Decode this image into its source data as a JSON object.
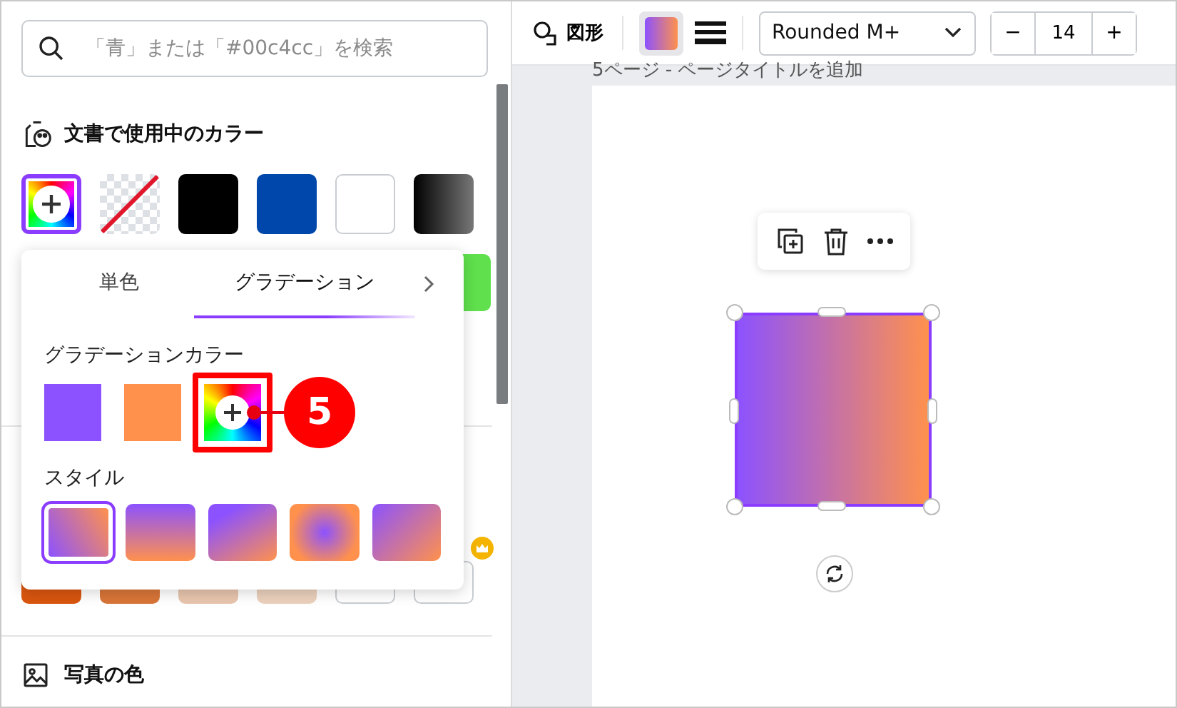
{
  "search": {
    "placeholder": "「青」または「#00c4cc」を検索"
  },
  "document_colors": {
    "title": "文書で使用中のカラー",
    "swatches": [
      {
        "kind": "add",
        "selected": true
      },
      {
        "kind": "none",
        "selected": false
      },
      {
        "kind": "solid",
        "color": "#000000",
        "selected": false
      },
      {
        "kind": "solid",
        "color": "#0047ab",
        "selected": false
      },
      {
        "kind": "solid",
        "color": "#ffffff",
        "selected": false
      },
      {
        "kind": "gradient",
        "color": "#000000",
        "selected": false
      }
    ]
  },
  "partly_hidden": {
    "top_swatch": {
      "color": "#5fe04c"
    },
    "bottom_swatches": [
      {
        "color": "#d9560f"
      },
      {
        "color": "#d97538"
      },
      {
        "color": "#e8c5ae"
      },
      {
        "color": "#ebd1bd"
      },
      {
        "color": "#ffffff"
      },
      {
        "color": "#ffffff"
      }
    ]
  },
  "popover": {
    "tabs": [
      {
        "label": "単色",
        "selected": false
      },
      {
        "label": "グラデーション",
        "selected": true
      }
    ],
    "gradient_colors": {
      "title": "グラデーションカラー",
      "swatches": [
        {
          "kind": "solid",
          "color": "#8c52ff",
          "highlighted": false
        },
        {
          "kind": "solid",
          "color": "#ff914d",
          "highlighted": false
        },
        {
          "kind": "add",
          "highlighted": true
        }
      ]
    },
    "callout": {
      "label": "5"
    },
    "styles": {
      "title": "スタイル",
      "items": [
        {
          "kind": "diagonal",
          "selected": true
        },
        {
          "kind": "vertical",
          "selected": false
        },
        {
          "kind": "diagonal-soft",
          "selected": false
        },
        {
          "kind": "radial",
          "selected": false
        },
        {
          "kind": "diagonal-wide",
          "selected": false
        }
      ]
    }
  },
  "photo_colors": {
    "title": "写真の色"
  },
  "toolbar": {
    "shape_label": "図形",
    "font": "Rounded M+",
    "decrement": "−",
    "size": "14",
    "increment": "+"
  },
  "page_label": "5ページ - ページタイトルを追加"
}
